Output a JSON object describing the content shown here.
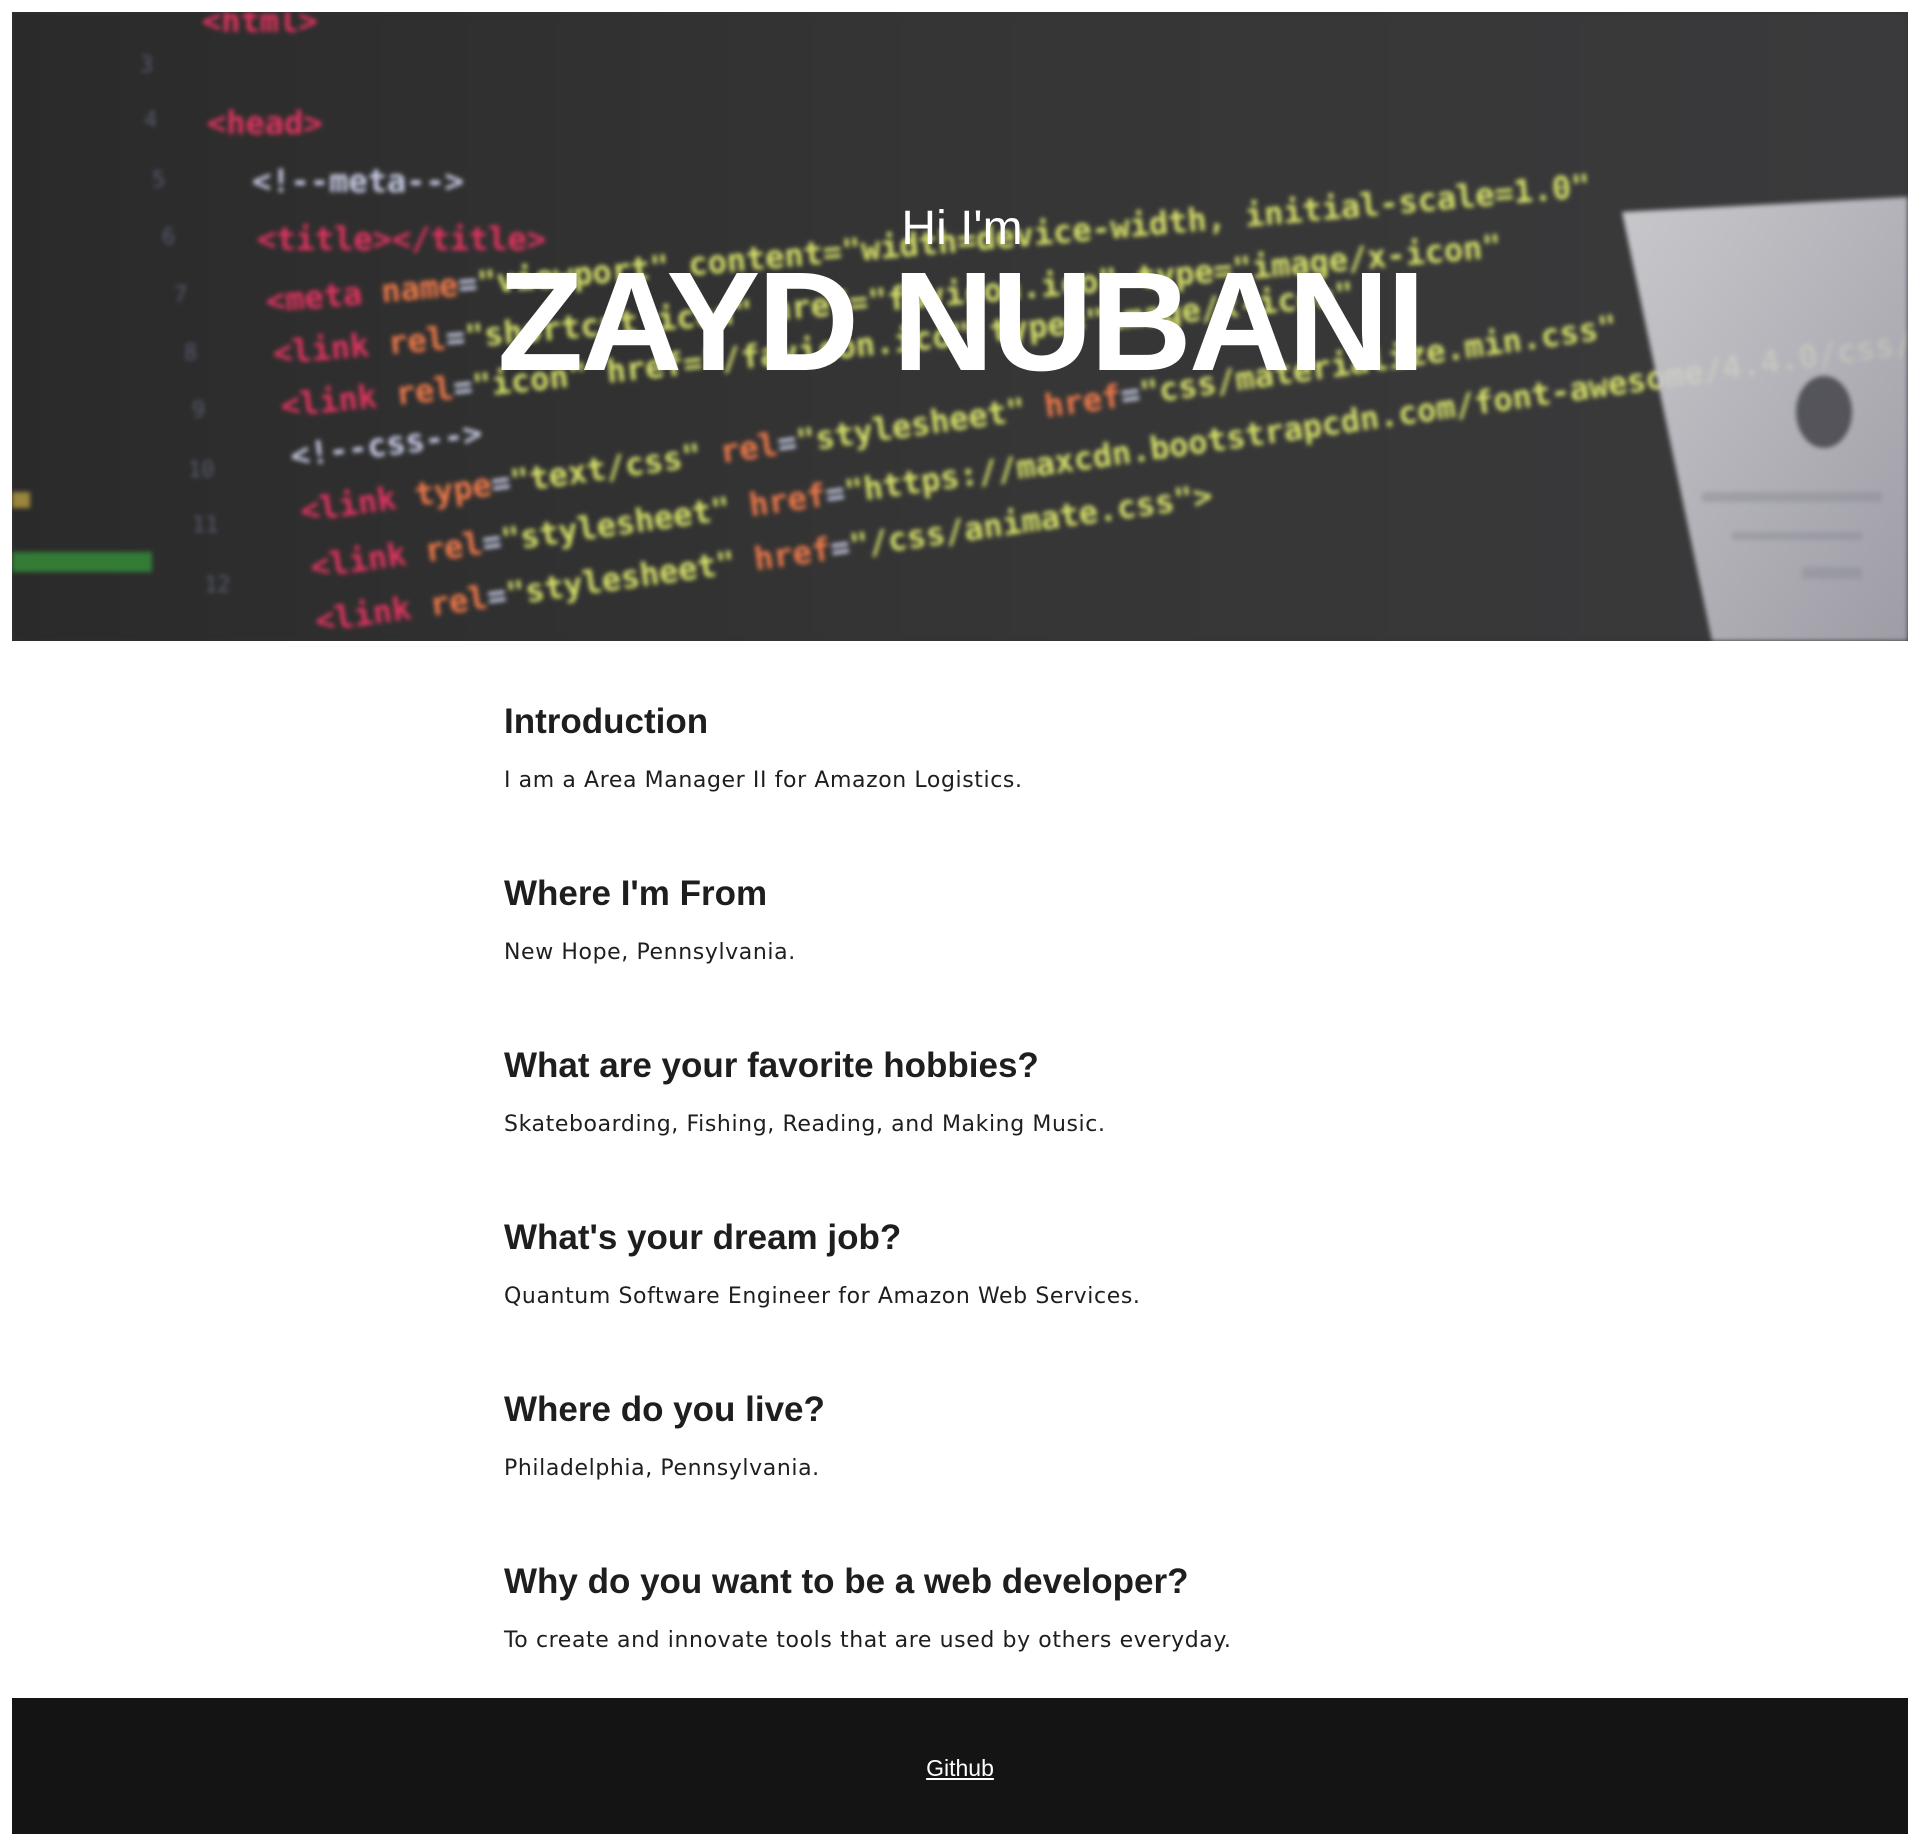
{
  "hero": {
    "greeting": "Hi I'm",
    "name": "ZAYD NUBANI",
    "background": "code-editor-photo"
  },
  "sections": [
    {
      "title": "Introduction",
      "text": "I am a Area Manager II for Amazon Logistics."
    },
    {
      "title": "Where I'm From",
      "text": "New Hope, Pennsylvania."
    },
    {
      "title": "What are your favorite hobbies?",
      "text": "Skateboarding, Fishing, Reading, and Making Music."
    },
    {
      "title": "What's your dream job?",
      "text": "Quantum Software Engineer for Amazon Web Services."
    },
    {
      "title": "Where do you live?",
      "text": "Philadelphia, Pennsylvania."
    },
    {
      "title": "Why do you want to be a web developer?",
      "text": "To create and innovate tools that are used by others everyday."
    }
  ],
  "footer": {
    "link_label": "Github"
  },
  "colors": {
    "hero_bg": "#333333",
    "footer_bg": "#141414",
    "text": "#1e1e1e",
    "code_tag": "#e0345f",
    "code_string": "#d9e36b",
    "code_attr": "#f07a4a"
  }
}
